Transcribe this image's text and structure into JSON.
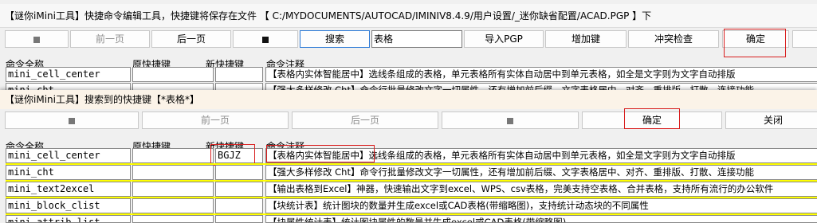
{
  "title": "【谜你iMini工具】快捷命令编辑工具，快捷键将保存在文件 【 C:/MYDOCUMENTS/AUTOCAD/IMINIV8.4.9/用户设置/_迷你缺省配置/ACAD.PGP 】下",
  "toolbar": {
    "prev": "前一页",
    "next": "后一页",
    "search": "搜索",
    "search_value": "表格",
    "import": "导入PGP",
    "add": "增加键",
    "conflict": "冲突检查",
    "ok": "确定"
  },
  "headers": {
    "full_name": "命令全称",
    "old_key": "原快捷键",
    "new_key": "新快捷键",
    "note": "命令注释"
  },
  "top_rows": [
    {
      "name": "mini_cell_center",
      "old": "",
      "new": "",
      "note": "【表格内实体智能居中】选线条组成的表格，单元表格所有实体自动居中到单元表格，如全是文字则为文字自动排版"
    },
    {
      "name": "mini_cht",
      "old": "",
      "new": "",
      "note": "【强大多样修改 Cht】命令行批量修改文字一切属性，还有增加前后缀、文字表格居中、对齐、重排版、打散、连接功能"
    }
  ],
  "dialog": {
    "title": "【谜你iMini工具】搜索到的快捷键【*表格*】",
    "prev": "前一页",
    "next": "后一页",
    "ok": "确定",
    "close": "关闭",
    "rows": [
      {
        "name": "mini_cell_center",
        "old": "",
        "new": "BGJZ",
        "note": "【表格内实体智能居中】选线条组成的表格，单元表格所有实体自动居中到单元表格，如全是文字则为文字自动排版"
      },
      {
        "name": "mini_cht",
        "old": "",
        "new": "",
        "note": "【强大多样修改 Cht】命令行批量修改文字一切属性，还有增加前后缀、文字表格居中、对齐、重排版、打散、连接功能"
      },
      {
        "name": "mini_text2excel",
        "old": "",
        "new": "",
        "note": "【输出表格到Excel】神器，快速输出文字到excel、WPS、csv表格，完美支持空表格、合并表格，支持所有流行的办公软件"
      },
      {
        "name": "mini_block_clist",
        "old": "",
        "new": "",
        "note": "【块统计表】统计图块的数量并生成excel或CAD表格(带缩略图)，支持统计动态块的不同属性"
      },
      {
        "name": "mini_attrib_list",
        "old": "",
        "new": "",
        "note": "【块属性统计表】统计图块属性的数量并生成excel或CAD表格(带缩略图)"
      }
    ]
  },
  "colors": {
    "highlight_box": "#d81e1e",
    "row_separator": "#ffff00",
    "focus_border": "#2f7bd6"
  }
}
